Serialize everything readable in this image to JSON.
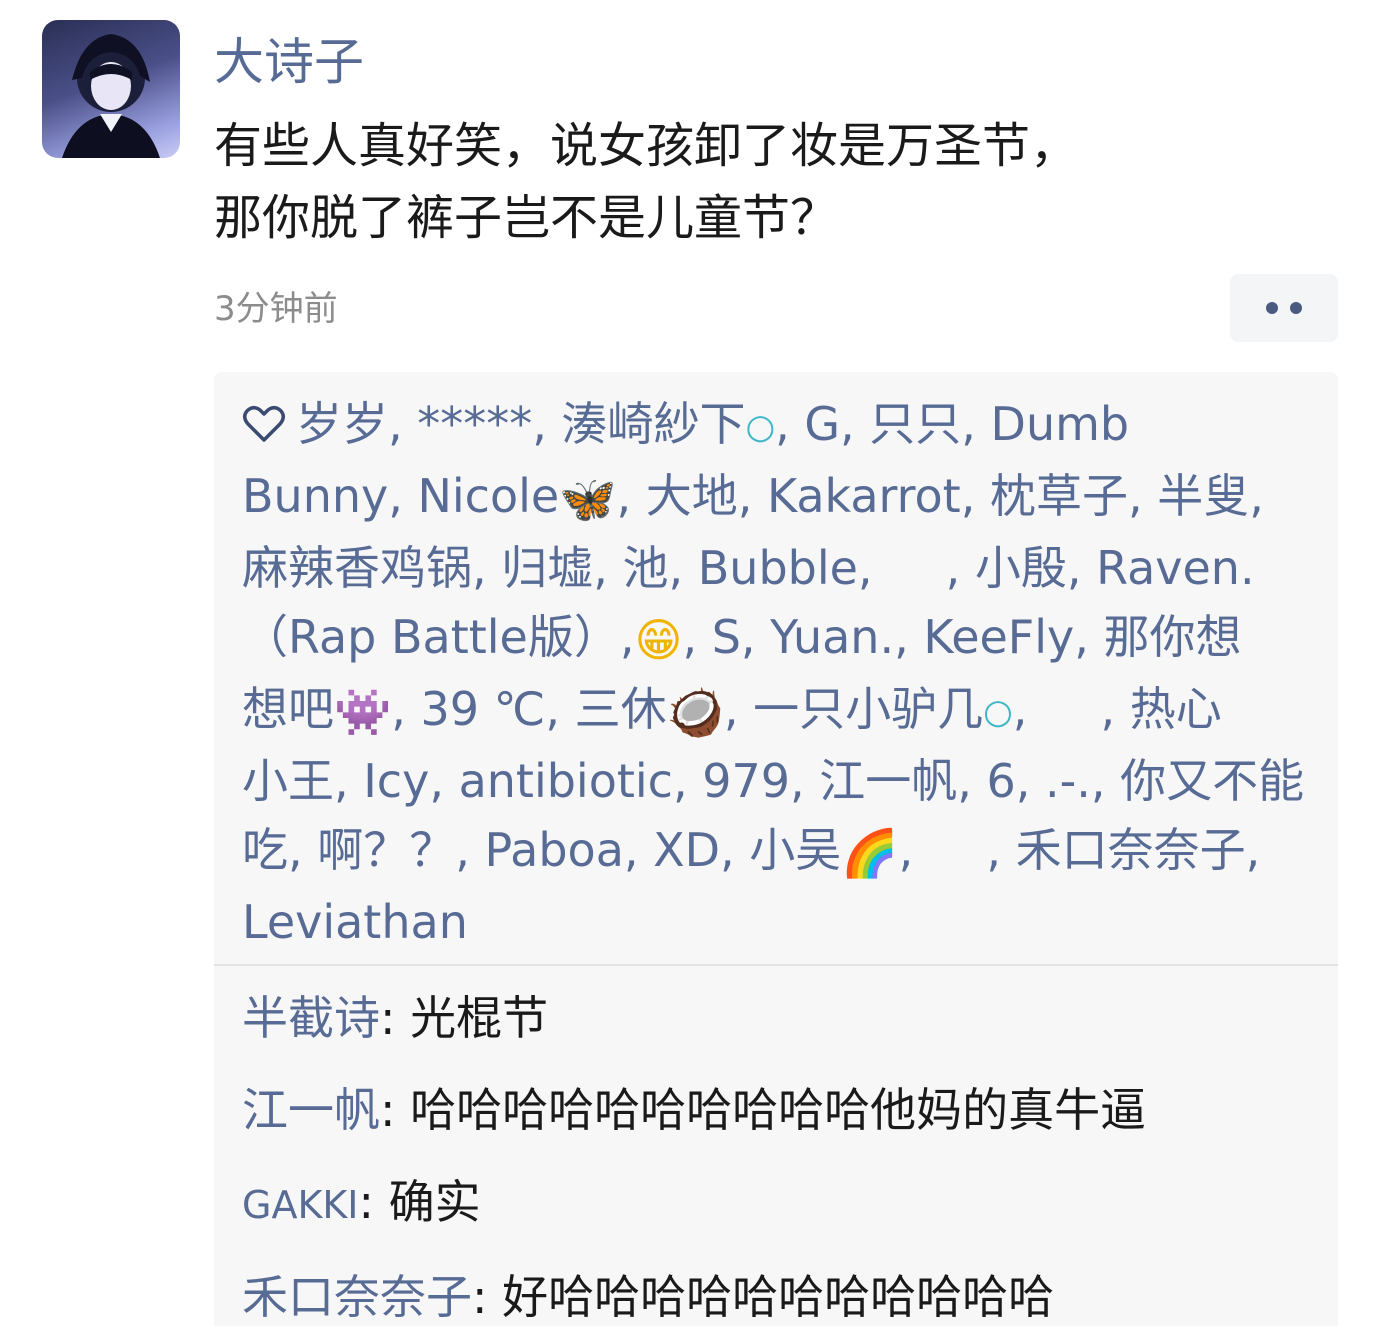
{
  "post": {
    "username": "大诗子",
    "content_lines": [
      "有些人真好笑，说女孩卸了妆是万圣节，",
      "那你脱了裤子岂不是儿童节？"
    ],
    "time": "3分钟前"
  },
  "likes": {
    "lines": [
      [
        "岁岁, *****, 湊崎紗下",
        "○",
        ", G, 只只, Dumb"
      ],
      [
        "Bunny, Nicole",
        "🦋",
        ", 大地, Kakarrot, 枕草子, 半叟,"
      ],
      [
        "麻辣香鸡锅, 归墟, 池, Bubble,     , 小殷, Raven."
      ],
      [
        "（Rap Battle版）,",
        "😁",
        ", S, Yuan., KeeFly, 那你想"
      ],
      [
        "想吧",
        "👾",
        ", 39 ℃, 三休",
        "🥥",
        ", 一只小驴几",
        "○",
        ",     , 热心"
      ],
      [
        "小王, Icy, antibiotic, 979, 江一帆, 6, .-., 你又不能"
      ],
      [
        "吃, 啊？？, Paboa, XD, 小吴",
        "🌈",
        ",     , 禾口奈奈子,"
      ],
      [
        "Leviathan"
      ]
    ]
  },
  "comments": [
    {
      "author": "半截诗",
      "text": ": 光棍节"
    },
    {
      "author": "江一帆",
      "text": ": 哈哈哈哈哈哈哈哈哈哈他妈的真牛逼"
    },
    {
      "author": "GAKKI",
      "text": ": 确实"
    },
    {
      "author": "禾口奈奈子",
      "text": ": 好哈哈哈哈哈哈哈哈哈哈哈"
    }
  ],
  "icons": {
    "avatar": "anime-avatar",
    "like": "heart-outline-icon",
    "more": "more-dots-icon"
  },
  "colors": {
    "link": "#576b95",
    "text": "#1a1a1a",
    "muted": "#8c8c8c",
    "panel": "#f7f7f7"
  }
}
